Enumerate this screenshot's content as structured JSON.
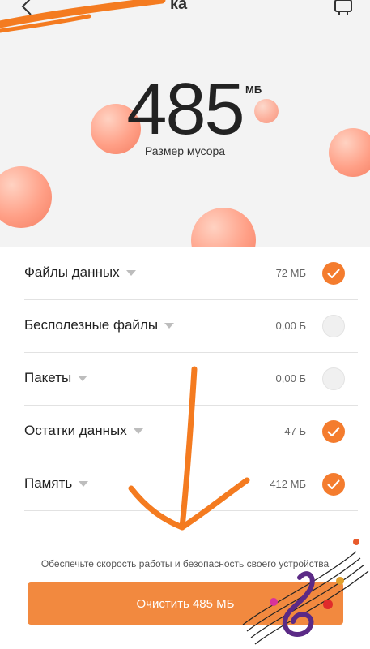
{
  "header": {
    "title_fragment": "ка"
  },
  "summary": {
    "size_value": "485",
    "size_unit": "МБ",
    "size_label": "Размер мусора"
  },
  "items": [
    {
      "label": "Файлы данных",
      "size": "72 МБ",
      "checked": true
    },
    {
      "label": "Бесполезные файлы",
      "size": "0,00 Б",
      "checked": false
    },
    {
      "label": "Пакеты",
      "size": "0,00 Б",
      "checked": false
    },
    {
      "label": "Остатки данных",
      "size": "47 Б",
      "checked": true
    },
    {
      "label": "Память",
      "size": "412 МБ",
      "checked": true
    }
  ],
  "footer": {
    "note": "Обеспечьте скорость работы и безопасность своего устройства",
    "clean_label": "Очистить 485 МБ"
  },
  "colors": {
    "accent": "#f47c2e",
    "button": "#f2893f",
    "annotation": "#f47b20"
  }
}
